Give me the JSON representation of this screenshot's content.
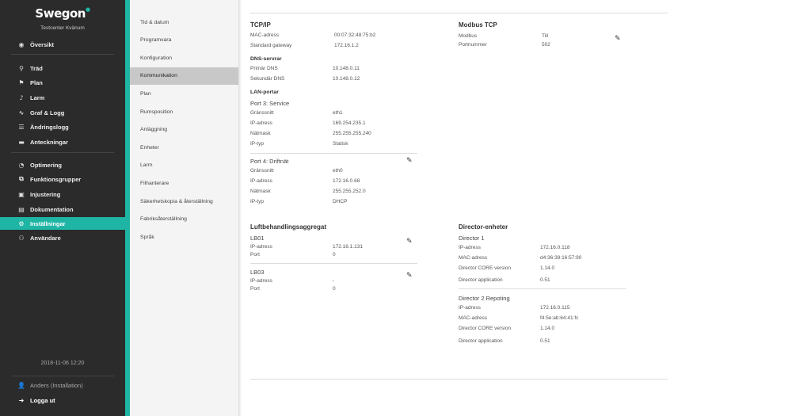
{
  "brand": {
    "logo": "Swegon",
    "site": "Testcenter Kvänum"
  },
  "nav": [
    {
      "label": "Översikt",
      "icon": "eye-icon"
    },
    {
      "label": "Träd",
      "icon": "tree-icon"
    },
    {
      "label": "Plan",
      "icon": "location-pin-icon"
    },
    {
      "label": "Larm",
      "icon": "bell-icon"
    },
    {
      "label": "Graf & Logg",
      "icon": "chart-icon"
    },
    {
      "label": "Ändringslogg",
      "icon": "list-icon"
    },
    {
      "label": "Anteckningar",
      "icon": "comment-icon"
    },
    {
      "label": "Optimering",
      "icon": "gauge-icon"
    },
    {
      "label": "Funktionsgrupper",
      "icon": "sitemap-icon"
    },
    {
      "label": "Injustering",
      "icon": "adjust-icon"
    },
    {
      "label": "Dokumentation",
      "icon": "book-icon"
    },
    {
      "label": "Inställningar",
      "icon": "gear-icon",
      "active": true
    },
    {
      "label": "Användare",
      "icon": "users-icon"
    }
  ],
  "datetime": "2018-11-06 12:20",
  "user": {
    "label": "Anders (Installation)",
    "icon": "user-icon"
  },
  "logout": {
    "label": "Logga ut",
    "icon": "logout-icon"
  },
  "submenu": [
    "Tid & datum",
    "Programvara",
    "Konfiguration",
    "Kommunikation",
    "Plan",
    "Rumsposition",
    "Anläggning",
    "Enheter",
    "Larm",
    "Filhanterare",
    "Säkerhetskopia & återställning",
    "Fabriksåterställning",
    "Språk"
  ],
  "submenu_active": "Kommunikation",
  "tcpip": {
    "title": "TCP/IP",
    "mac_label": "MAC-adress",
    "mac": "00:07:32:48:75:b2",
    "gw_label": "Standard gateway",
    "gw": "172.16.1.2",
    "dns_title": "DNS-servrar",
    "dns1_label": "Primär DNS",
    "dns1": "10.148.0.11",
    "dns2_label": "Sekundär DNS",
    "dns2": "10.148.0.12",
    "lan_title": "LAN-portar",
    "port3": {
      "title": "Port 3: Service",
      "if_label": "Gränssnitt",
      "if": "eth1",
      "ip_label": "IP-adress",
      "ip": "169.254.235.1",
      "mask_label": "Nätmask",
      "mask": "255.255.255.240",
      "type_label": "IP-typ",
      "type": "Statisk"
    },
    "port4": {
      "title": "Port 4: Driftnät",
      "if_label": "Gränssnitt",
      "if": "eth0",
      "ip_label": "IP-adress",
      "ip": "172.16.0.68",
      "mask_label": "Nätmask",
      "mask": "255.255.252.0",
      "type_label": "IP-typ",
      "type": "DHCP"
    }
  },
  "modbus": {
    "title": "Modbus TCP",
    "modbus_label": "Modbus",
    "modbus": "Till",
    "port_label": "Portnummer",
    "port": "502"
  },
  "ahu": {
    "title": "Luftbehandlingsaggregat",
    "lb01": {
      "name": "LB01",
      "ip_label": "IP-adress",
      "ip": "172.16.1.131",
      "port_label": "Port",
      "port": "0"
    },
    "lb03": {
      "name": "LB03",
      "ip_label": "IP-adress",
      "ip": "-",
      "port_label": "Port",
      "port": "0"
    }
  },
  "director": {
    "title": "Director-enheter",
    "d1": {
      "name": "Director 1",
      "ip_label": "IP-adress",
      "ip": "172.16.0.118",
      "mac_label": "MAC-adress",
      "mac": "d4:36:39:16:57:90",
      "core_label": "Director CORE version",
      "core": "1.14.0",
      "app_label": "Director application",
      "app": "0.51"
    },
    "d2": {
      "name": "Director 2 Repoting",
      "ip_label": "IP-adress",
      "ip": "172.16.0.115",
      "mac_label": "MAC-adress",
      "mac": "f4:5e:ab:64:41:fc",
      "core_label": "Director CORE version",
      "core": "1.14.0",
      "app_label": "Director application",
      "app": "0.51"
    }
  }
}
